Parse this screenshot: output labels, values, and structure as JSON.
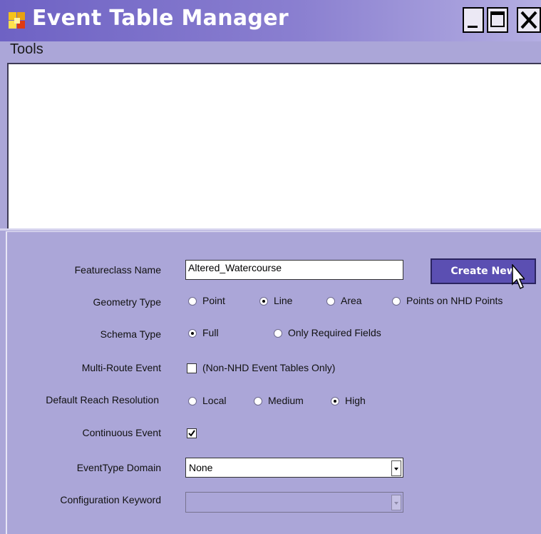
{
  "window": {
    "title": "Event Table Manager",
    "colors": {
      "titlebar": "#6e62c4",
      "panel": "#aba6d8",
      "button": "#5b4fb2"
    }
  },
  "menu": {
    "tools": "Tools"
  },
  "form": {
    "featureclass": {
      "label": "Featureclass Name",
      "value": "Altered_Watercourse"
    },
    "create_button": "Create New",
    "geometry": {
      "label": "Geometry Type",
      "options": [
        "Point",
        "Line",
        "Area",
        "Points on NHD Points"
      ],
      "selected": "Line"
    },
    "schema": {
      "label": "Schema Type",
      "options": [
        "Full",
        "Only Required Fields"
      ],
      "selected": "Full"
    },
    "multi_route": {
      "label": "Multi-Route Event",
      "checkbox_text": "(Non-NHD Event Tables Only)",
      "checked": false
    },
    "reach_resolution": {
      "label": "Default Reach Resolution",
      "options": [
        "Local",
        "Medium",
        "High"
      ],
      "selected": "High"
    },
    "continuous": {
      "label": "Continuous Event",
      "checked": true
    },
    "event_type_domain": {
      "label": "EventType Domain",
      "value": "None"
    },
    "config_keyword": {
      "label": "Configuration Keyword",
      "value": ""
    }
  },
  "icons": [
    "app-icon",
    "minimize-icon",
    "maximize-icon",
    "close-icon",
    "chevron-down-icon",
    "check-icon",
    "mouse-cursor-icon"
  ]
}
